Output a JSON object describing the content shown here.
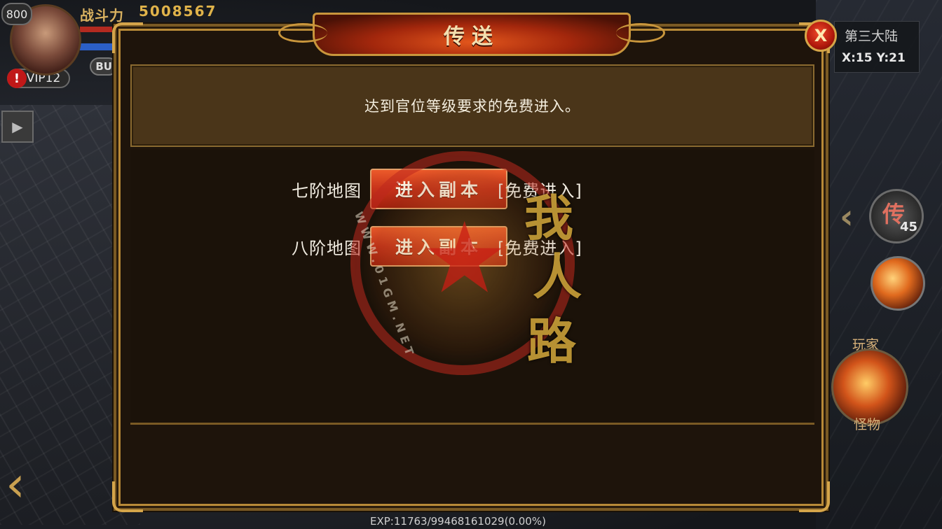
{
  "hud": {
    "level": "800",
    "power_label": "战斗力",
    "power_value": "5008567",
    "vip": "VIP12",
    "buff": "BU",
    "alert": "!"
  },
  "zone": {
    "name": "第三大陆",
    "coords": "X:15 Y:21"
  },
  "skills": {
    "teleport_glyph": "传",
    "teleport_count": "45",
    "player_label": "玩家",
    "monster_label": "怪物"
  },
  "exp_text": "EXP:11763/99468161029(0.00%)",
  "dialog": {
    "title": "传送",
    "close_label": "X",
    "info_text": "达到官位等级要求的免费进入。",
    "rows": [
      {
        "label": "七阶地图",
        "button": "进入副本",
        "tag": "[免费进入]"
      },
      {
        "label": "八阶地图",
        "button": "进入副本",
        "tag": "[免费进入]"
      }
    ]
  },
  "watermark": {
    "chars": [
      "我",
      "人",
      "路"
    ],
    "url": "WWW.01GM.NET"
  },
  "colors": {
    "dialog_border": "#7a5a24",
    "button_red": "#c7321a",
    "gold_text": "#e0b34a"
  }
}
